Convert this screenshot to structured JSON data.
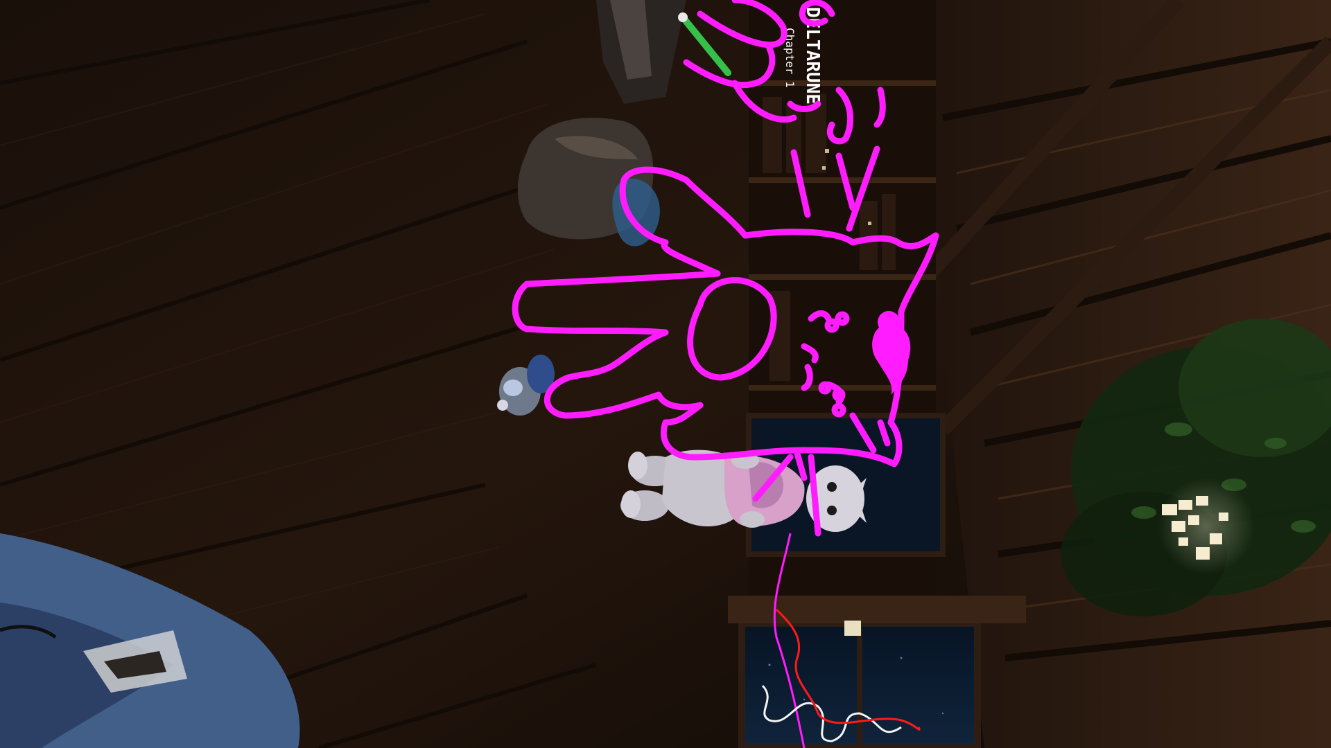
{
  "scene": {
    "in_world_texts": [
      {
        "id": "game-logo",
        "text": "DELTARUNE"
      },
      {
        "id": "chapter-label",
        "text": "Chapter 1"
      }
    ],
    "colors": {
      "drawing_magenta": "#ff1cff",
      "drawing_white": "#f4f4f4",
      "drawing_red": "#ff1a1a",
      "wood_dark": "#1e130c",
      "wood_mid": "#2e1d12",
      "wood_light": "#3a2416",
      "window_night": "#0c1d33",
      "leaf_green": "#1f3b18",
      "lamp_glow": "#f6ecd0",
      "avatar_gray": "#c9c5ce",
      "avatar_pink": "#d7a1c9",
      "cloth_blue": "#425f8a",
      "pencil_green": "#36c04a"
    },
    "objects": [
      "pink-whiteboard-doodle",
      "cat-avatar",
      "bookshelf",
      "night-window",
      "hanging-plant",
      "paper-lanterns",
      "green-marker-pen",
      "blue-cloth",
      "white-scribble",
      "red-scribble"
    ]
  }
}
